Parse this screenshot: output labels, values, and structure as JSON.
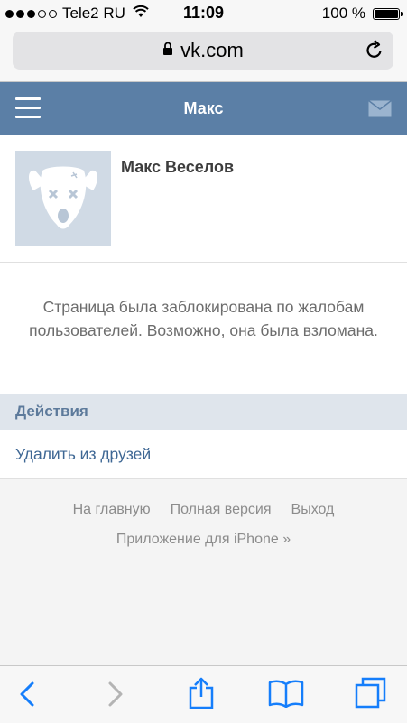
{
  "status_bar": {
    "carrier": "Tele2 RU",
    "time": "11:09",
    "battery": "100 %",
    "signal_bars_filled": 3,
    "signal_bars_total": 5
  },
  "browser": {
    "url": "vk.com"
  },
  "header": {
    "title": "Макс"
  },
  "profile": {
    "name": "Макс Веселов"
  },
  "blocked_message": "Страница была заблокирована по жалобам пользователей. Возможно, она была взломана.",
  "actions": {
    "title": "Действия",
    "remove_friend": "Удалить из друзей"
  },
  "footer": {
    "home": "На главную",
    "full_version": "Полная версия",
    "logout": "Выход",
    "iphone_app": "Приложение для iPhone »"
  },
  "colors": {
    "header_bg": "#5b7fa6",
    "link": "#3e6794",
    "ios_blue": "#157efb"
  }
}
